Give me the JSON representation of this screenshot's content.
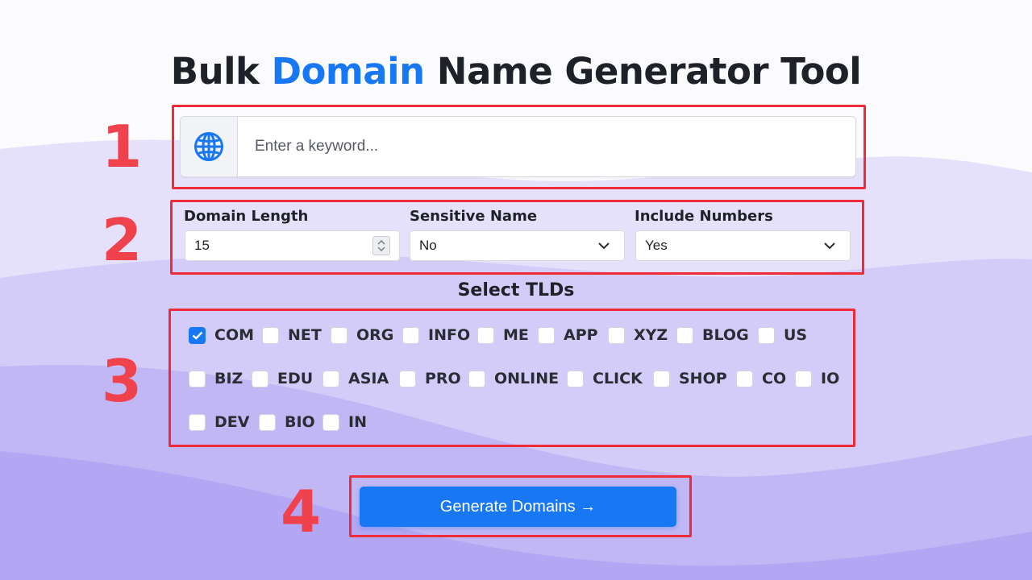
{
  "page": {
    "title_part1": "Bulk ",
    "title_highlight": "Domain",
    "title_part2": " Name Generator Tool"
  },
  "keyword": {
    "placeholder": "Enter a keyword...",
    "value": "",
    "icon": "globe-icon"
  },
  "options": {
    "domain_length": {
      "label": "Domain Length",
      "value": "15"
    },
    "sensitive_name": {
      "label": "Sensitive Name",
      "value": "No"
    },
    "include_numbers": {
      "label": "Include Numbers",
      "value": "Yes"
    }
  },
  "tlds": {
    "heading": "Select TLDs",
    "items": [
      {
        "label": "COM",
        "checked": true
      },
      {
        "label": "NET",
        "checked": false
      },
      {
        "label": "ORG",
        "checked": false
      },
      {
        "label": "INFO",
        "checked": false
      },
      {
        "label": "ME",
        "checked": false
      },
      {
        "label": "APP",
        "checked": false
      },
      {
        "label": "XYZ",
        "checked": false
      },
      {
        "label": "BLOG",
        "checked": false
      },
      {
        "label": "US",
        "checked": false
      },
      {
        "label": "BIZ",
        "checked": false
      },
      {
        "label": "EDU",
        "checked": false
      },
      {
        "label": "ASIA",
        "checked": false
      },
      {
        "label": "PRO",
        "checked": false
      },
      {
        "label": "ONLINE",
        "checked": false
      },
      {
        "label": "CLICK",
        "checked": false
      },
      {
        "label": "SHOP",
        "checked": false
      },
      {
        "label": "CO",
        "checked": false
      },
      {
        "label": "IO",
        "checked": false
      },
      {
        "label": "DEV",
        "checked": false
      },
      {
        "label": "BIO",
        "checked": false
      },
      {
        "label": "IN",
        "checked": false
      }
    ]
  },
  "generate": {
    "label": "Generate Domains →"
  },
  "annotations": {
    "n1": "1",
    "n2": "2",
    "n3": "3",
    "n4": "4"
  },
  "colors": {
    "accent": "#1877f2",
    "highlight_box": "#ef2b3a",
    "annotation_number": "#f0424c"
  }
}
